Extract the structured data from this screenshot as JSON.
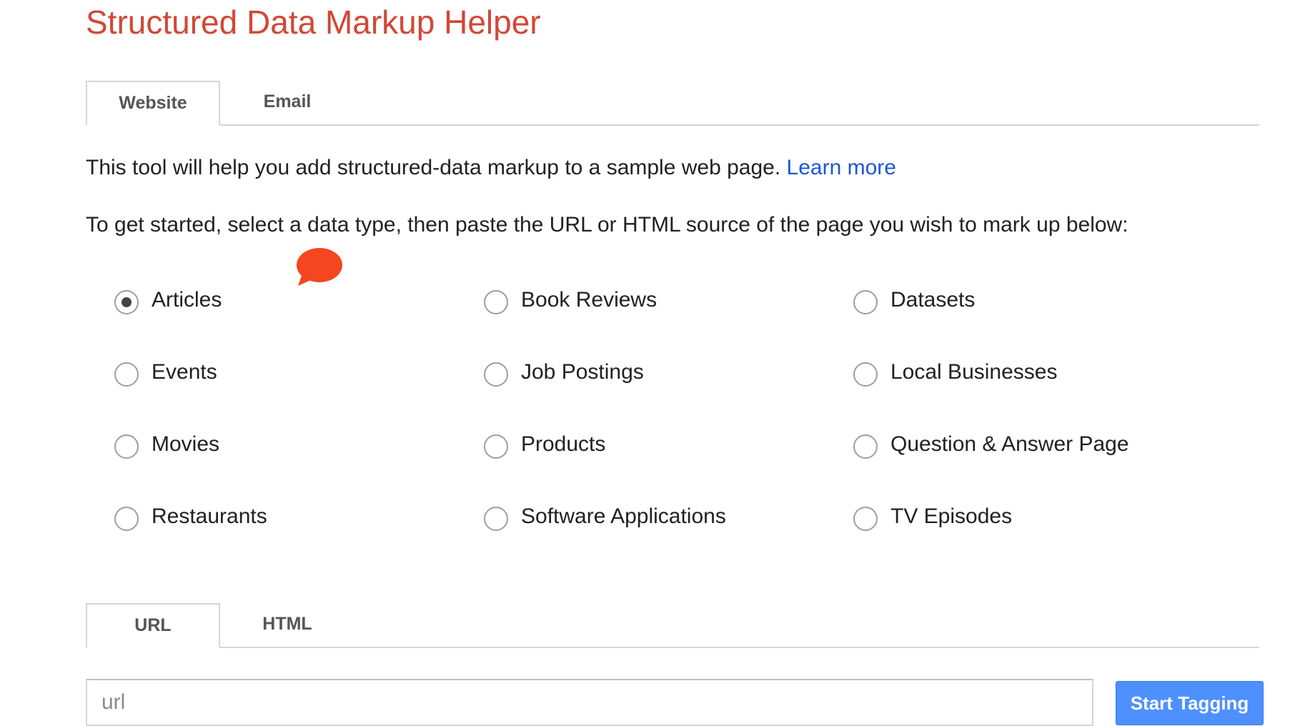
{
  "title": "Structured Data Markup Helper",
  "top_tabs": [
    {
      "label": "Website",
      "active": true
    },
    {
      "label": "Email",
      "active": false
    }
  ],
  "description": "This tool will help you add structured-data markup to a sample web page.",
  "learn_more": "Learn more",
  "instructions": "To get started, select a data type, then paste the URL or HTML source of the page you wish to mark up below:",
  "data_types": [
    {
      "label": "Articles",
      "checked": true
    },
    {
      "label": "Book Reviews",
      "checked": false
    },
    {
      "label": "Datasets",
      "checked": false
    },
    {
      "label": "Events",
      "checked": false
    },
    {
      "label": "Job Postings",
      "checked": false
    },
    {
      "label": "Local Businesses",
      "checked": false
    },
    {
      "label": "Movies",
      "checked": false
    },
    {
      "label": "Products",
      "checked": false
    },
    {
      "label": "Question & Answer Page",
      "checked": false
    },
    {
      "label": "Restaurants",
      "checked": false
    },
    {
      "label": "Software Applications",
      "checked": false
    },
    {
      "label": "TV Episodes",
      "checked": false
    }
  ],
  "source_tabs": [
    {
      "label": "URL",
      "active": true
    },
    {
      "label": "HTML",
      "active": false
    }
  ],
  "url_input": {
    "value": "",
    "placeholder": "url"
  },
  "start_button": "Start Tagging",
  "colors": {
    "title": "#d14836",
    "link": "#1a57d6",
    "button": "#4d90fe",
    "bubble": "#f4461f"
  }
}
